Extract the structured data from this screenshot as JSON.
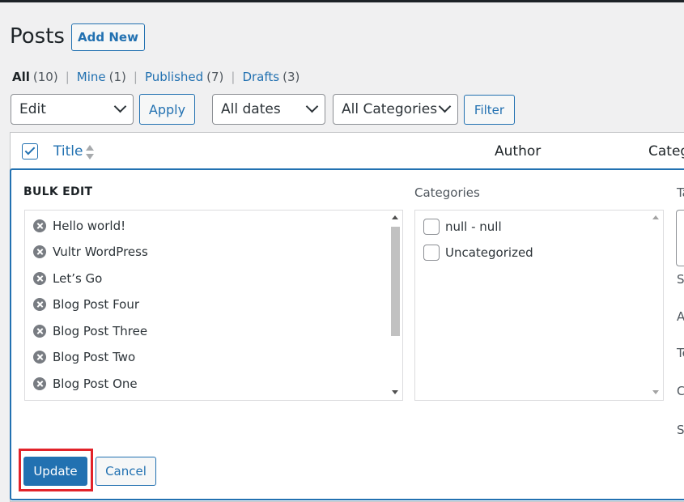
{
  "header": {
    "title": "Posts",
    "add_new_label": "Add New"
  },
  "views": {
    "all": {
      "label": "All",
      "count": "(10)"
    },
    "mine": {
      "label": "Mine",
      "count": "(1)"
    },
    "published": {
      "label": "Published",
      "count": "(7)"
    },
    "drafts": {
      "label": "Drafts",
      "count": "(3)"
    },
    "separator": "|"
  },
  "filters": {
    "bulk_action": "Edit",
    "apply_label": "Apply",
    "dates": "All dates",
    "categories": "All Categories",
    "filter_label": "Filter"
  },
  "table": {
    "col_title": "Title",
    "col_author": "Author",
    "col_categories": "Categ"
  },
  "bulk_edit": {
    "heading": "BULK EDIT",
    "posts": [
      "Hello world!",
      "Vultr WordPress",
      "Let’s Go",
      "Blog Post Four",
      "Blog Post Three",
      "Blog Post Two",
      "Blog Post One"
    ],
    "categories_label": "Categories",
    "categories": [
      "null - null",
      "Uncategorized"
    ],
    "tags_label": "Ta",
    "side_labels": [
      "Se",
      "A",
      "Te",
      "C",
      "St"
    ],
    "update_label": "Update",
    "cancel_label": "Cancel"
  },
  "colors": {
    "accent": "#2271b1",
    "highlight": "#e2232a"
  }
}
